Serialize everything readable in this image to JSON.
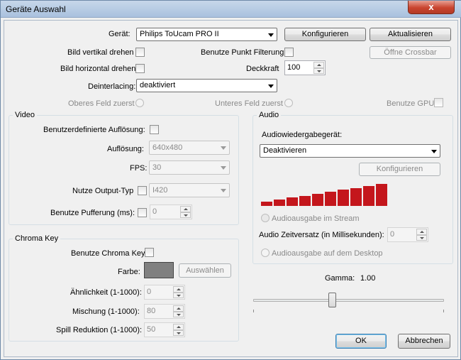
{
  "window": {
    "title": "Geräte Auswahl",
    "close_glyph": "x"
  },
  "device": {
    "label": "Gerät:",
    "value": "Philips ToUcam PRO II",
    "configure_label": "Konfigurieren",
    "refresh_label": "Aktualisieren",
    "crossbar_label": "Öffne Crossbar",
    "flip_v_label": "Bild vertikal drehen",
    "flip_h_label": "Bild horizontal drehen",
    "point_filter_label": "Benutze Punkt Filterung",
    "opacity_label": "Deckkraft",
    "opacity_value": "100",
    "deinterlace_label": "Deinterlacing:",
    "deinterlace_value": "deaktiviert",
    "top_field_label": "Oberes Feld zuerst",
    "bottom_field_label": "Unteres Feld zuerst",
    "gpu_label": "Benutze GPU"
  },
  "video": {
    "group_title": "Video",
    "custom_res_label": "Benutzerdefinierte Auflösung:",
    "res_label": "Auflösung:",
    "res_value": "640x480",
    "fps_label": "FPS:",
    "fps_value": "30",
    "output_type_label": "Nutze Output-Typ",
    "output_type_value": "I420",
    "buffer_label": "Benutze Pufferung (ms):",
    "buffer_value": "0"
  },
  "audio": {
    "group_title": "Audio",
    "playback_device_label": "Audiowiedergabegerät:",
    "playback_device_value": "Deaktivieren",
    "configure_label": "Konfigurieren",
    "volume_level": 1.0,
    "volume_color": "#c4161c",
    "stream_output_label": "Audioausgabe im Stream",
    "offset_label": "Audio Zeitversatz (in Millisekunden):",
    "offset_value": "0",
    "desktop_output_label": "Audioausgabe auf dem Desktop"
  },
  "chroma": {
    "group_title": "Chroma Key",
    "use_label": "Benutze Chroma Key",
    "color_label": "Farbe:",
    "color_value": "#808080",
    "choose_label": "Auswählen",
    "similarity_label": "Ähnlichkeit (1-1000):",
    "similarity_value": "0",
    "blend_label": "Mischung (1-1000):",
    "blend_value": "80",
    "spill_label": "Spill Reduktion (1-1000):",
    "spill_value": "50"
  },
  "gamma": {
    "label": "Gamma:",
    "value": "1.00",
    "value_number": 1.0,
    "slider_fraction": 0.41
  },
  "footer": {
    "ok_label": "OK",
    "cancel_label": "Abbrechen"
  }
}
